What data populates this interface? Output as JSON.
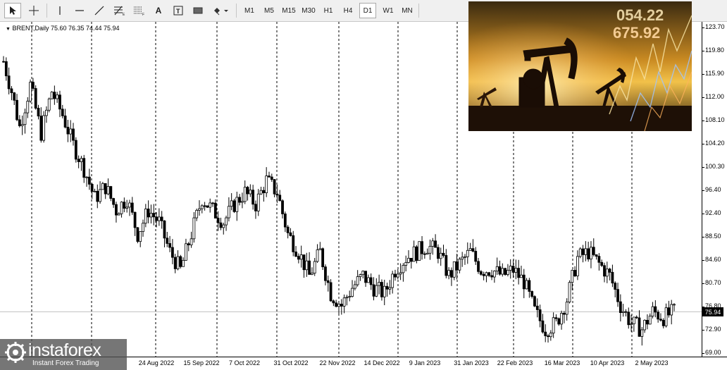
{
  "toolbar": {
    "timeframes": [
      "M1",
      "M5",
      "M15",
      "M30",
      "H1",
      "H4",
      "D1",
      "W1",
      "MN"
    ],
    "active_timeframe": "D1",
    "tools": [
      "cursor-icon",
      "crosshair-icon",
      "vertical-line-icon",
      "horizontal-line-icon",
      "trendline-icon",
      "fibonacci-icon",
      "grid-tool-icon",
      "text-tool-icon",
      "text-label-icon",
      "rectangle-icon",
      "shapes-dropdown-icon"
    ]
  },
  "symbol_info": "BRENT,Daily  75.60 76.35 74.44 75.94",
  "photo": {
    "ticker_values": [
      "054.22",
      "675.92"
    ]
  },
  "watermark": {
    "brand": "instaforex",
    "tagline": "Instant Forex Trading"
  },
  "current_price_label": "75.94",
  "chart_data": {
    "type": "candlestick",
    "symbol": "BRENT",
    "timeframe": "Daily",
    "ohlc": {
      "open": 75.6,
      "high": 76.35,
      "low": 74.44,
      "close": 75.94
    },
    "y_ticks": [
      "123.70",
      "119.80",
      "115.90",
      "112.00",
      "108.10",
      "104.20",
      "100.30",
      "96.40",
      "92.40",
      "88.50",
      "84.60",
      "80.70",
      "76.80",
      "72.90",
      "69.00"
    ],
    "ylim": [
      69.0,
      123.7
    ],
    "x_ticks": [
      "24 Aug 2022",
      "15 Sep 2022",
      "7 Oct 2022",
      "31 Oct 2022",
      "22 Nov 2022",
      "14 Dec 2022",
      "9 Jan 2023",
      "31 Jan 2023",
      "22 Feb 2023",
      "16 Mar 2023",
      "10 Apr 2023",
      "2 May 2023"
    ],
    "price_path": [
      [
        0,
        118.0
      ],
      [
        6,
        113.0
      ],
      [
        12,
        107.0
      ],
      [
        20,
        114.0
      ],
      [
        28,
        106.0
      ],
      [
        36,
        113.0
      ],
      [
        44,
        109.0
      ],
      [
        52,
        104.0
      ],
      [
        60,
        100.0
      ],
      [
        68,
        95.0
      ],
      [
        76,
        97.0
      ],
      [
        84,
        93.0
      ],
      [
        92,
        95.0
      ],
      [
        100,
        89.0
      ],
      [
        108,
        93.0
      ],
      [
        116,
        91.0
      ],
      [
        124,
        86.0
      ],
      [
        132,
        83.0
      ],
      [
        140,
        89.0
      ],
      [
        148,
        95.0
      ],
      [
        156,
        93.0
      ],
      [
        164,
        91.0
      ],
      [
        172,
        94.0
      ],
      [
        180,
        96.0
      ],
      [
        188,
        94.0
      ],
      [
        196,
        98.0
      ],
      [
        204,
        96.0
      ],
      [
        212,
        89.0
      ],
      [
        220,
        86.0
      ],
      [
        228,
        82.0
      ],
      [
        236,
        86.0
      ],
      [
        244,
        79.0
      ],
      [
        252,
        77.0
      ],
      [
        260,
        80.0
      ],
      [
        268,
        82.0
      ],
      [
        276,
        80.0
      ],
      [
        284,
        79.0
      ],
      [
        292,
        83.0
      ],
      [
        300,
        85.0
      ],
      [
        308,
        86.0
      ],
      [
        316,
        87.0
      ],
      [
        324,
        86.0
      ],
      [
        332,
        82.0
      ],
      [
        340,
        84.0
      ],
      [
        348,
        86.0
      ],
      [
        356,
        83.0
      ],
      [
        364,
        83.0
      ],
      [
        372,
        82.0
      ],
      [
        380,
        83.0
      ],
      [
        388,
        81.0
      ],
      [
        396,
        76.0
      ],
      [
        404,
        73.0
      ],
      [
        412,
        74.0
      ],
      [
        420,
        78.0
      ],
      [
        428,
        85.0
      ],
      [
        436,
        86.0
      ],
      [
        444,
        84.0
      ],
      [
        452,
        82.0
      ],
      [
        460,
        77.0
      ],
      [
        468,
        74.0
      ],
      [
        476,
        73.0
      ],
      [
        484,
        76.0
      ],
      [
        492,
        75.0
      ],
      [
        500,
        75.94
      ]
    ]
  }
}
